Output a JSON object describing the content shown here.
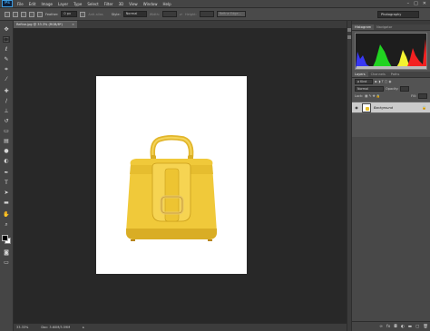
{
  "app": {
    "logo": "Ps"
  },
  "menu": [
    "File",
    "Edit",
    "Image",
    "Layer",
    "Type",
    "Select",
    "Filter",
    "3D",
    "View",
    "Window",
    "Help"
  ],
  "window_controls": {
    "minimize": "–",
    "maximize": "□",
    "close": "✕"
  },
  "options": {
    "feather_label": "Feather:",
    "feather_value": "0 px",
    "antialias_label": "Anti-alias",
    "style_label": "Style:",
    "style_value": "Normal",
    "width_label": "Width:",
    "height_label": "Height:",
    "refine_edge": "Refine Edge..."
  },
  "workspace": "Photography",
  "document": {
    "tab_title": "Refine.jpg @ 33.3% (RGB/8*)",
    "close": "×"
  },
  "status": {
    "zoom": "33.33%",
    "doc_info": "Doc: 3.60M/3.59M"
  },
  "panels": {
    "top_tabs": [
      "Histogram",
      "Navigator"
    ],
    "layer_tabs": [
      "Layers",
      "Channels",
      "Paths"
    ],
    "kind_label": "ρ Kind",
    "blend_mode": "Normal",
    "opacity_label": "Opacity:",
    "lock_label": "Lock:",
    "fill_label": "Fill:",
    "layer_name": "Background"
  },
  "icons": {
    "tools": [
      "move-icon",
      "marquee-icon",
      "lasso-icon",
      "quick-selection-icon",
      "crop-icon",
      "eyedropper-icon",
      "healing-brush-icon",
      "brush-icon",
      "clone-stamp-icon",
      "history-brush-icon",
      "eraser-icon",
      "gradient-icon",
      "blur-icon",
      "dodge-icon",
      "pen-icon",
      "type-icon",
      "path-selection-icon",
      "rectangle-icon",
      "hand-icon",
      "zoom-icon"
    ],
    "footer": [
      "link-icon",
      "fx-icon",
      "mask-icon",
      "adjustment-icon",
      "folder-icon",
      "new-layer-icon",
      "trash-icon"
    ]
  },
  "colors": {
    "bag_yellow": "#f0c93a",
    "bag_shadow": "#c99d1b",
    "canvas_bg": "#282828",
    "accent_blue": "#3c9de0"
  }
}
